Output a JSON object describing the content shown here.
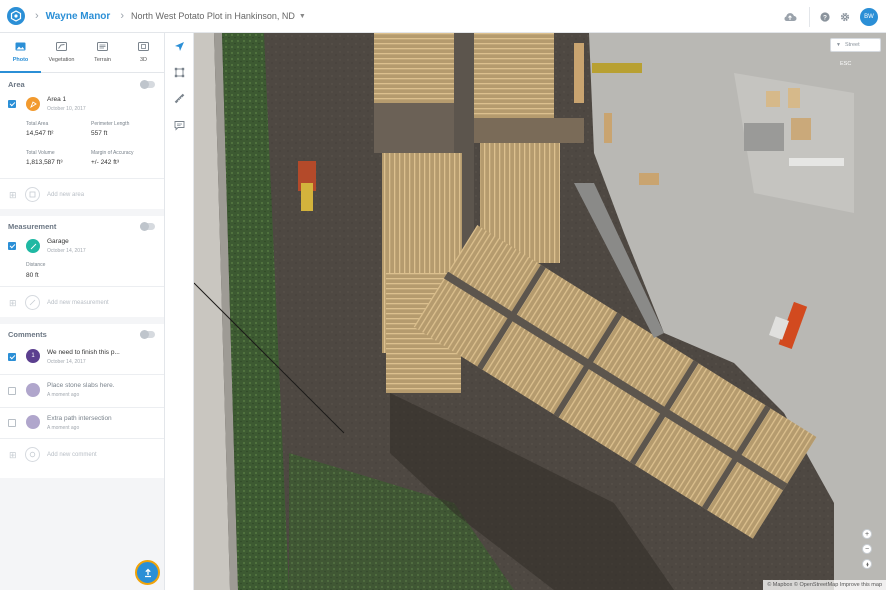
{
  "header": {
    "org": "Wayne Manor",
    "project": "North West Potato Plot in Hankinson, ND",
    "avatar_initials": "BW"
  },
  "tabs": [
    {
      "label": "Photo",
      "icon": "photo-icon",
      "active": true
    },
    {
      "label": "Vegetation",
      "icon": "vegetation-icon",
      "active": false
    },
    {
      "label": "Terrain",
      "icon": "terrain-icon",
      "active": false
    },
    {
      "label": "3D",
      "icon": "3d-icon",
      "active": false
    }
  ],
  "area": {
    "title": "Area",
    "item": {
      "name": "Area 1",
      "date": "October 10, 2017",
      "total_area_label": "Total Area",
      "total_area_value": "14,547 ft²",
      "perimeter_label": "Perimeter Length",
      "perimeter_value": "557 ft",
      "total_volume_label": "Total Volume",
      "total_volume_value": "1,813,587 ft³",
      "accuracy_label": "Margin of Accuracy",
      "accuracy_value": "+/- 242 ft³"
    },
    "add_label": "Add new area"
  },
  "measurement": {
    "title": "Measurement",
    "item": {
      "name": "Garage",
      "date": "October 14, 2017",
      "distance_label": "Distance",
      "distance_value": "80 ft"
    },
    "add_label": "Add new measurement"
  },
  "comments": {
    "title": "Comments",
    "items": [
      {
        "badge": "1",
        "text": "We need to finish this p...",
        "date": "October 14, 2017",
        "checked": true,
        "color": "#5b3f8f"
      },
      {
        "badge": "",
        "text": "Place stone slabs here.",
        "date": "A moment ago",
        "checked": false,
        "color": "#b0a6cc"
      },
      {
        "badge": "",
        "text": "Extra path intersection",
        "date": "A moment ago",
        "checked": false,
        "color": "#b0a6cc"
      }
    ],
    "add_label": "Add new comment"
  },
  "map": {
    "style_label": "Street",
    "esc_label": "ESC",
    "attribution": "© Mapbox  © OpenStreetMap  Improve this map"
  },
  "colors": {
    "accent": "#2b8fd6",
    "area_badge": "#f29a2e",
    "measure_badge": "#1fb8a3",
    "fab_ring": "#f0a30a"
  }
}
